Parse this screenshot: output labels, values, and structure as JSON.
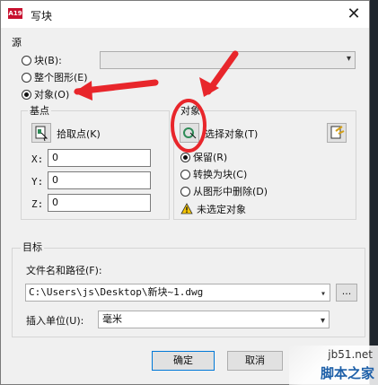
{
  "window": {
    "title": "写块",
    "app_icon_text": "A19",
    "close_glyph": "✕"
  },
  "source": {
    "legend": "源",
    "options": [
      {
        "label": "块(B):",
        "selected": false
      },
      {
        "label": "整个图形(E)",
        "selected": false
      },
      {
        "label": "对象(O)",
        "selected": true
      }
    ],
    "block_select_value": ""
  },
  "base_point": {
    "legend": "基点",
    "pick_label": "拾取点(K)",
    "x_label": "X:",
    "x_value": "0",
    "y_label": "Y:",
    "y_value": "0",
    "z_label": "Z:",
    "z_value": "0"
  },
  "objects": {
    "legend": "对象",
    "select_label": "选择对象(T)",
    "options": [
      {
        "label": "保留(R)",
        "selected": true
      },
      {
        "label": "转换为块(C)",
        "selected": false
      },
      {
        "label": "从图形中删除(D)",
        "selected": false
      }
    ],
    "warning": "未选定对象"
  },
  "destination": {
    "legend": "目标",
    "path_label": "文件名和路径(F):",
    "path_value": "C:\\Users\\js\\Desktop\\新块~1.dwg",
    "browse_label": "...",
    "units_label": "插入单位(U):",
    "units_value": "毫米"
  },
  "buttons": {
    "ok": "确定",
    "cancel": "取消"
  },
  "watermark": {
    "site": "jb51.net",
    "name": "脚本之家"
  },
  "colors": {
    "annotation_red": "#e8262b",
    "dialog_bg": "#f0f0f0",
    "backdrop": "#1f262e"
  }
}
